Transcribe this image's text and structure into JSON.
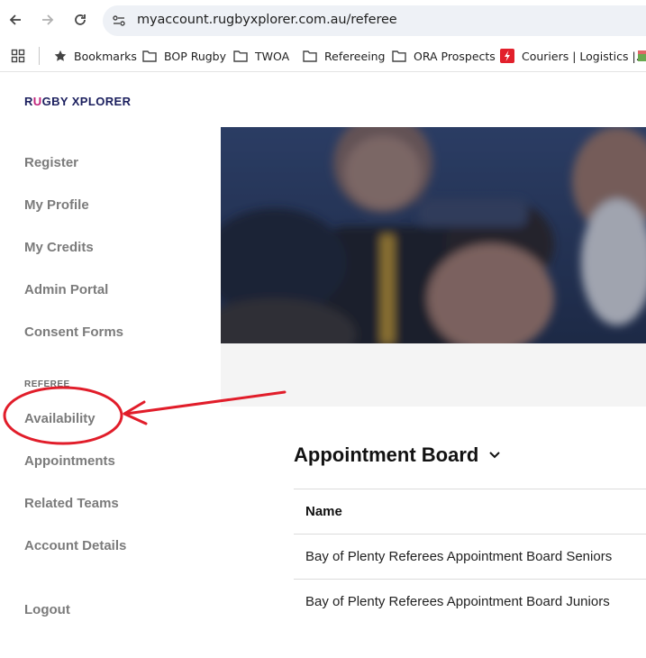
{
  "browser": {
    "url": "myaccount.rugbyxplorer.com.au/referee",
    "bookmarks": [
      "Bookmarks",
      "BOP Rugby",
      "TWOA",
      "Refereeing",
      "ORA Prospects",
      "Couriers | Logistics |..."
    ]
  },
  "brand": {
    "logo_pre": "R",
    "logo_u": "U",
    "logo_post": "GBY XPLORER",
    "color_navy": "#1b1f5e",
    "color_accent": "#c0227a"
  },
  "sidebar": {
    "items": [
      "Register",
      "My Profile",
      "My Credits",
      "Admin Portal",
      "Consent Forms"
    ],
    "section_label": "REFEREE",
    "referee_items": [
      "Availability",
      "Appointments",
      "Related Teams",
      "Account Details"
    ],
    "logout": "Logout"
  },
  "main": {
    "board_title": "Appointment Board",
    "table": {
      "header": "Name",
      "rows": [
        "Bay of Plenty Referees Appointment Board Seniors",
        "Bay of Plenty Referees Appointment Board Juniors"
      ]
    }
  },
  "annotation": {
    "color": "#e11d2a"
  }
}
